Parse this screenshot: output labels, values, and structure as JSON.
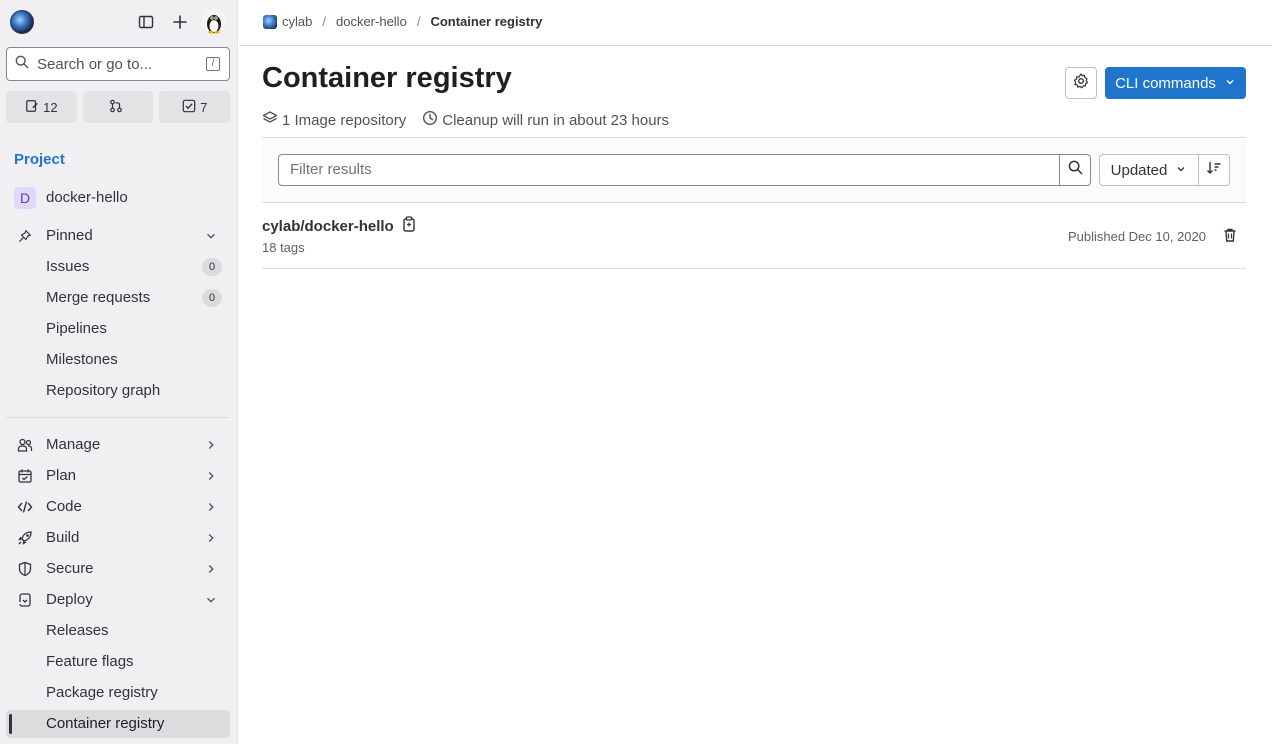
{
  "sidebar": {
    "search_placeholder": "Search or go to...",
    "search_shortcut": "/",
    "counts": {
      "issues": "12",
      "merge_requests": "",
      "todos": "7"
    },
    "section_label": "Project",
    "project": {
      "avatar_letter": "D",
      "name": "docker-hello"
    },
    "pinned": {
      "label": "Pinned",
      "items": [
        {
          "label": "Issues",
          "badge": "0"
        },
        {
          "label": "Merge requests",
          "badge": "0"
        },
        {
          "label": "Pipelines"
        },
        {
          "label": "Milestones"
        },
        {
          "label": "Repository graph"
        }
      ]
    },
    "groups": [
      {
        "label": "Manage"
      },
      {
        "label": "Plan"
      },
      {
        "label": "Code"
      },
      {
        "label": "Build"
      },
      {
        "label": "Secure"
      },
      {
        "label": "Deploy"
      }
    ],
    "deploy_items": [
      {
        "label": "Releases"
      },
      {
        "label": "Feature flags"
      },
      {
        "label": "Package registry"
      },
      {
        "label": "Container registry"
      }
    ]
  },
  "breadcrumb": {
    "group": "cylab",
    "project": "docker-hello",
    "current": "Container registry"
  },
  "page": {
    "title": "Container registry",
    "cli_label": "CLI commands",
    "meta": {
      "repos": "1 Image repository",
      "cleanup": "Cleanup will run in about 23 hours"
    },
    "filter_placeholder": "Filter results",
    "sort_label": "Updated"
  },
  "repositories": [
    {
      "name": "cylab/docker-hello",
      "tags": "18 tags",
      "published": "Published Dec 10, 2020"
    }
  ],
  "colors": {
    "accent": "#1f75cb",
    "sidebar_bg": "#f0f0f2"
  }
}
